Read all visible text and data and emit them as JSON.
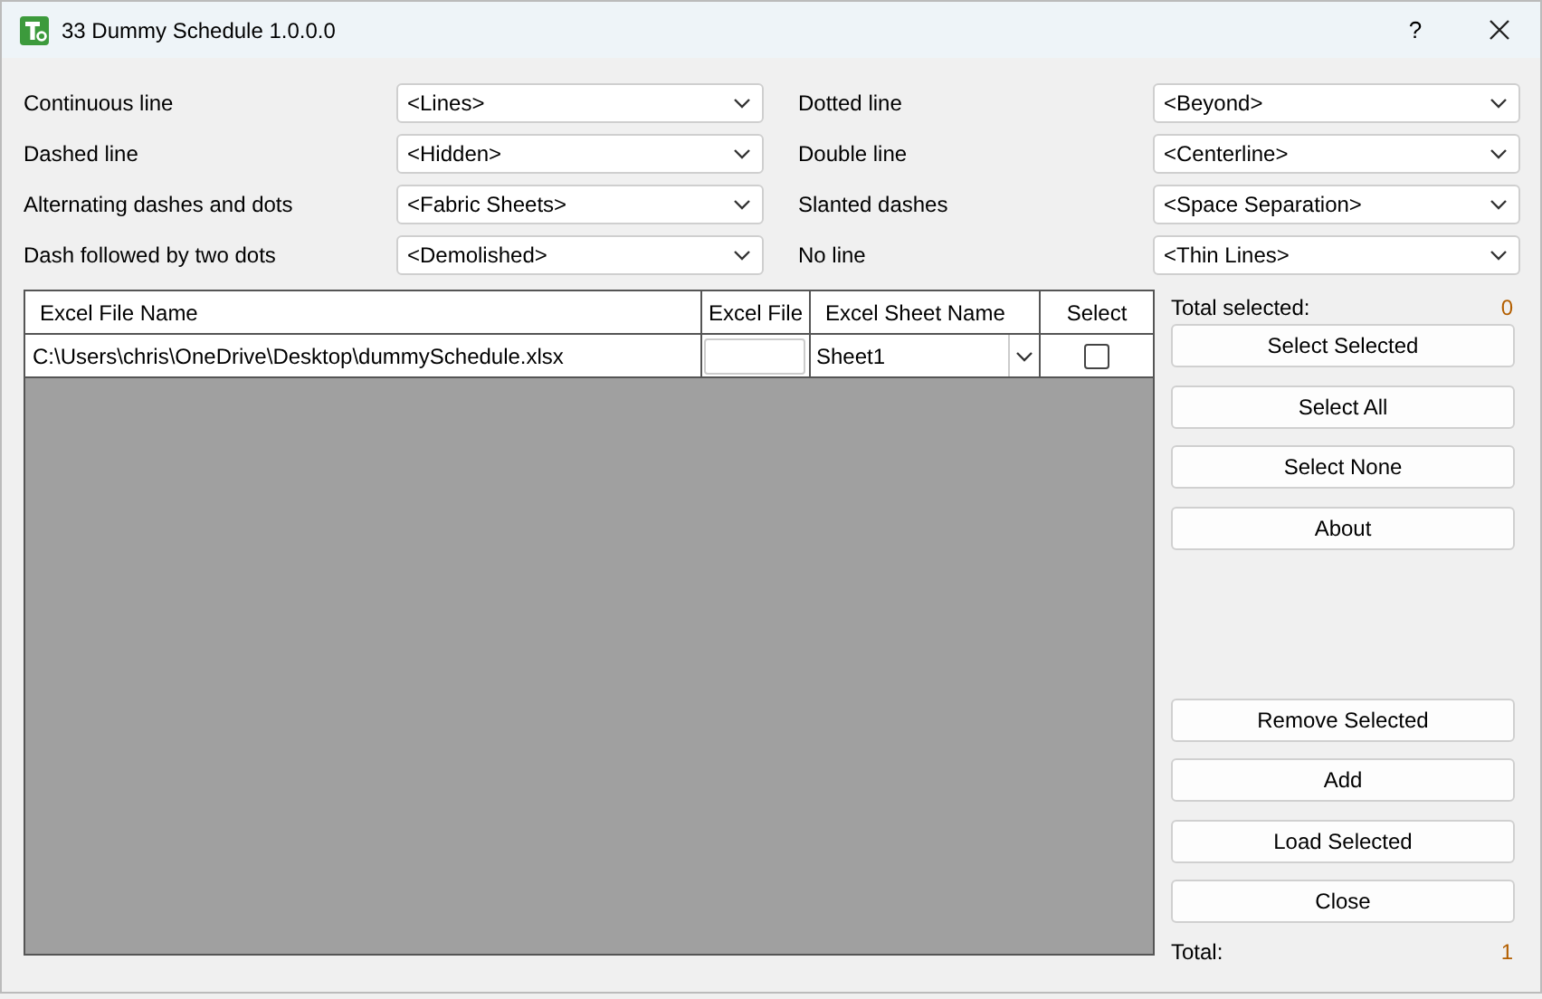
{
  "window": {
    "title": "33 Dummy Schedule 1.0.0.0",
    "help": "?"
  },
  "line_styles": [
    {
      "label": "Continuous line",
      "value": "<Lines>"
    },
    {
      "label": "Dotted line",
      "value": "<Beyond>"
    },
    {
      "label": "Dashed line",
      "value": "<Hidden>"
    },
    {
      "label": "Double line",
      "value": "<Centerline>"
    },
    {
      "label": "Alternating dashes and dots",
      "value": "<Fabric Sheets>"
    },
    {
      "label": "Slanted dashes",
      "value": "<Space Separation>"
    },
    {
      "label": "Dash followed by two dots",
      "value": "<Demolished>"
    },
    {
      "label": "No line",
      "value": "<Thin Lines>"
    }
  ],
  "table": {
    "columns": [
      "Excel File Name",
      "Excel File",
      "Excel Sheet Name",
      "Select"
    ],
    "rows": [
      {
        "file_name": "C:\\Users\\chris\\OneDrive\\Desktop\\dummySchedule.xlsx",
        "sheet": "Sheet1",
        "checked": false
      }
    ]
  },
  "side": {
    "total_selected_label": "Total selected:",
    "total_selected": "0",
    "top_buttons": [
      "Select Selected",
      "Select All",
      "Select None",
      "About"
    ],
    "bottom_buttons": [
      "Remove Selected",
      "Add",
      "Load Selected",
      "Close"
    ],
    "total_label": "Total:",
    "total": "1"
  }
}
